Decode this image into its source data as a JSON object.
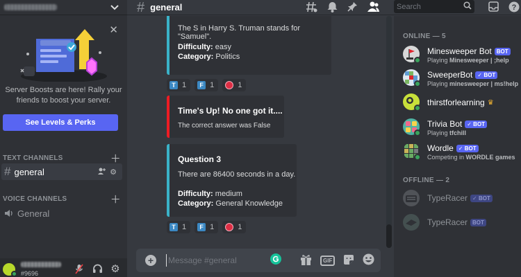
{
  "sidebar": {
    "boost": {
      "text": "Server Boosts are here! Rally your friends to boost your server.",
      "button": "See Levels & Perks"
    },
    "categories": {
      "text": "TEXT CHANNELS",
      "voice": "VOICE CHANNELS"
    },
    "channels": {
      "general_text": "general",
      "general_voice": "General"
    },
    "user": {
      "tag": "#9696"
    }
  },
  "header": {
    "channel": "general",
    "search_placeholder": "Search"
  },
  "messages": [
    {
      "text": "The S in Harry S. Truman stands for \"Samuel\".",
      "difficulty_label": "Difficulty:",
      "difficulty": "easy",
      "category_label": "Category:",
      "category": "Politics",
      "reactions": [
        {
          "emoji": "T",
          "count": "1"
        },
        {
          "emoji": "F",
          "count": "1"
        },
        {
          "emoji": "red-circle",
          "count": "1"
        }
      ]
    },
    {
      "title": "Time's Up! No one got it....",
      "text": "The correct answer was False"
    },
    {
      "title": "Question 3",
      "text": "There are 86400 seconds in a day.",
      "difficulty_label": "Difficulty:",
      "difficulty": "medium",
      "category_label": "Category:",
      "category": "General Knowledge",
      "reactions": [
        {
          "emoji": "T",
          "count": "1"
        },
        {
          "emoji": "F",
          "count": "1"
        },
        {
          "emoji": "red-circle",
          "count": "1"
        }
      ]
    }
  ],
  "composer": {
    "placeholder": "Message #general",
    "gif_label": "GIF"
  },
  "members": {
    "online_header": "ONLINE — 5",
    "offline_header": "OFFLINE — 2",
    "bot_tag": "BOT",
    "online": [
      {
        "name": "Minesweeper Bot",
        "bot": true,
        "verified": false,
        "activity_prefix": "Playing ",
        "activity": "Minesweeper | ;help",
        "avatar_color": "#d8d8d8"
      },
      {
        "name": "SweeperBot",
        "bot": true,
        "verified": true,
        "activity_prefix": "Playing ",
        "activity": "minesweeper | ms!help",
        "avatar_color": "#7bb661"
      },
      {
        "name": "thirstforlearning",
        "bot": false,
        "verified": false,
        "activity_prefix": "",
        "activity": "",
        "avatar_color": "#b7d82b"
      },
      {
        "name": "Trivia Bot",
        "bot": true,
        "verified": true,
        "activity_prefix": "Playing ",
        "activity": "tfchill",
        "avatar_color": "#4fb3a3"
      },
      {
        "name": "Wordle",
        "bot": true,
        "verified": true,
        "activity_prefix": "Competing in ",
        "activity": "WORDLE games",
        "avatar_color": "#6aaa64"
      }
    ],
    "offline": [
      {
        "name": "TypeRacer",
        "bot": true,
        "verified": true
      },
      {
        "name": "TypeRacer",
        "bot": true,
        "verified": false
      }
    ]
  },
  "colors": {
    "accent": "#5865f2",
    "embed_accent": "#3ab2c8",
    "embed_alert": "#ed1c24",
    "online": "#3ba55d"
  }
}
